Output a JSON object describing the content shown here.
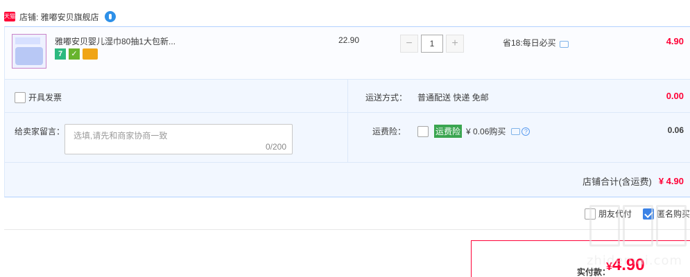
{
  "store": {
    "badge": "天猫",
    "label": "店铺: 雅嘟安贝旗舰店"
  },
  "item": {
    "title": "雅嘟安贝婴儿湿巾80抽1大包新...",
    "icon_7": "7",
    "unit_price": "22.90",
    "quantity": "1",
    "qty_minus": "−",
    "qty_plus": "+",
    "promo": "省18:每日必买",
    "total": "4.90"
  },
  "invoice": {
    "label": "开具发票"
  },
  "shipping": {
    "label": "运送方式：",
    "value": "普通配送 快递 免邮",
    "price": "0.00"
  },
  "message": {
    "label": "给卖家留言：",
    "placeholder": "选填,请先和商家协商一致",
    "count": "0/200"
  },
  "insurance": {
    "label": "运费险：",
    "tag": "运费险",
    "price_text": "¥ 0.06购买",
    "help": "?",
    "amount": "0.06"
  },
  "subtotal": {
    "label": "店铺合计(含运费)",
    "price": "¥ 4.90"
  },
  "options": {
    "friend_pay": "朋友代付",
    "anonymous": "匿名购买"
  },
  "payment": {
    "label": "实付款：",
    "currency": "¥",
    "amount": "4.90"
  },
  "watermark": {
    "text": "zhidemai.com"
  },
  "colors": {
    "accent_red": "#ff0036",
    "panel_bg": "#f2f7ff",
    "border_blue": "#b2d1ff",
    "checkbox_blue": "#3b82e6",
    "insurance_green": "#3aa550"
  }
}
